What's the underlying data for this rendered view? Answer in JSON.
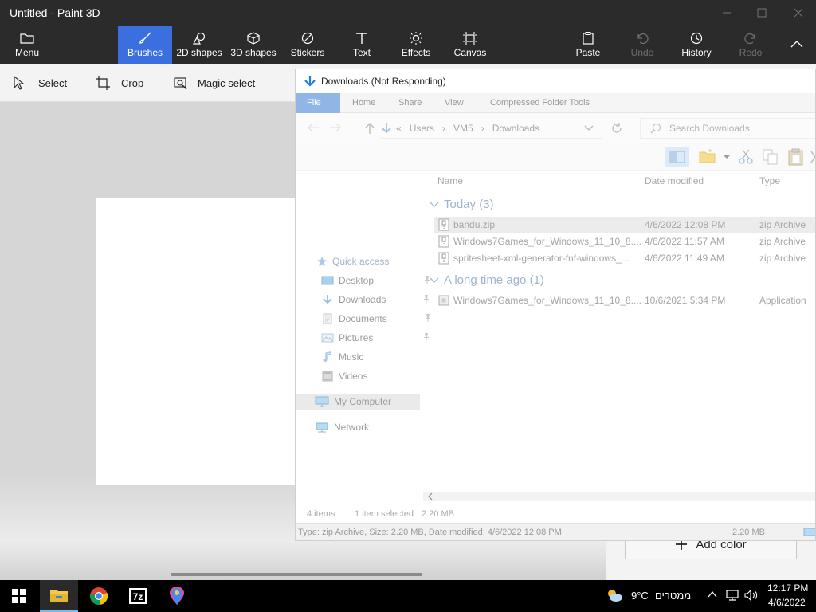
{
  "app": {
    "title": "Untitled - Paint 3D"
  },
  "ribbon": {
    "menu": "Menu",
    "brushes": "Brushes",
    "shapes2d": "2D shapes",
    "shapes3d": "3D shapes",
    "stickers": "Stickers",
    "text": "Text",
    "effects": "Effects",
    "canvas": "Canvas",
    "paste": "Paste",
    "undo": "Undo",
    "history": "History",
    "redo": "Redo"
  },
  "toolbar": {
    "select": "Select",
    "crop": "Crop",
    "magic_select": "Magic select"
  },
  "side_panel": {
    "add_color": "Add color"
  },
  "explorer": {
    "title": "Downloads (Not Responding)",
    "tabs": {
      "file": "File",
      "home": "Home",
      "share": "Share",
      "view": "View",
      "compressed": "Compressed Folder Tools"
    },
    "address": {
      "chevrons": "«",
      "crumbs": [
        "Users",
        "VM5",
        "Downloads"
      ]
    },
    "search_placeholder": "Search Downloads",
    "nav": {
      "quick_access": "Quick access",
      "desktop": "Desktop",
      "downloads": "Downloads",
      "documents": "Documents",
      "pictures": "Pictures",
      "music": "Music",
      "videos": "Videos",
      "my_computer": "My Computer",
      "network": "Network"
    },
    "columns": {
      "name": "Name",
      "date": "Date modified",
      "type": "Type"
    },
    "groups": {
      "today": "Today (3)",
      "long_ago": "A long time ago (1)"
    },
    "files": [
      {
        "name": "bandu.zip",
        "date": "4/6/2022 12:08 PM",
        "type": "zip Archive"
      },
      {
        "name": "Windows7Games_for_Windows_11_10_8....",
        "date": "4/6/2022 11:57 AM",
        "type": "zip Archive"
      },
      {
        "name": "spritesheet-xml-generator-fnf-windows_...",
        "date": "4/6/2022 11:49 AM",
        "type": "zip Archive"
      },
      {
        "name": "Windows7Games_for_Windows_11_10_8....",
        "date": "10/6/2021 5:34 PM",
        "type": "Application"
      }
    ],
    "status": {
      "items": "4 items",
      "selected": "1 item selected",
      "size": "2.20 MB"
    },
    "details": {
      "text": "Type: zip Archive, Size: 2.20 MB, Date modified: 4/6/2022 12:08 PM",
      "size": "2.20 MB"
    }
  },
  "taskbar": {
    "weather_temp": "9°C",
    "weather_label": "ממטרים",
    "time": "12:17 PM",
    "date": "4/6/2022"
  }
}
